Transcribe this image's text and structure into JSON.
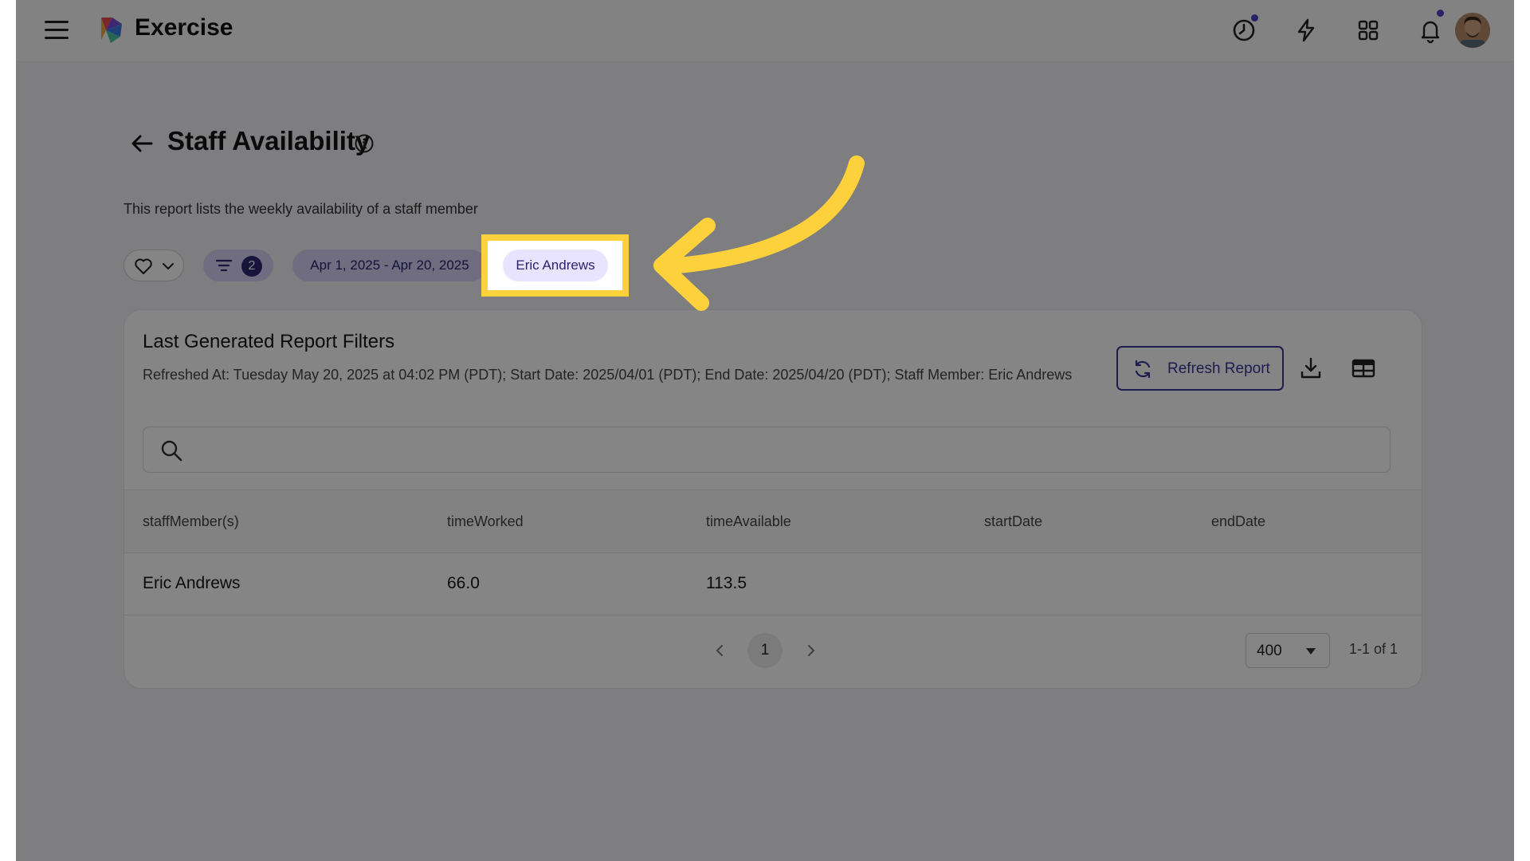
{
  "app": {
    "title": "Exercise"
  },
  "topbar": {
    "icons": [
      "clock-icon",
      "lightning-icon",
      "apps-grid-icon",
      "bell-icon"
    ],
    "accent_dot_color": "#4b43c8"
  },
  "page": {
    "title": "Staff Availability",
    "description": "This report lists the weekly availability of a staff member"
  },
  "filters": {
    "count": "2",
    "date_range": "Apr 1, 2025 - Apr 20, 2025",
    "staff_member": "Eric Andrews"
  },
  "card": {
    "title": "Last Generated Report Filters",
    "meta": "Refreshed At: Tuesday May 20, 2025 at 04:02 PM (PDT); Start Date: 2025/04/01 (PDT); End Date: 2025/04/20 (PDT); Staff Member: Eric Andrews",
    "refresh_label": "Refresh Report",
    "search_placeholder": ""
  },
  "table": {
    "columns": [
      "staffMember(s)",
      "timeWorked",
      "timeAvailable",
      "startDate",
      "endDate"
    ],
    "rows": [
      {
        "staff": "Eric Andrews",
        "worked": "66.0",
        "available": "113.5",
        "start": "",
        "end": ""
      }
    ]
  },
  "pagination": {
    "current_page": "1",
    "page_size": "400",
    "range": "1-1 of 1"
  },
  "colors": {
    "highlight": "#fcd13c",
    "chip_bg": "#d8d2f7",
    "primary": "#3d3596"
  }
}
